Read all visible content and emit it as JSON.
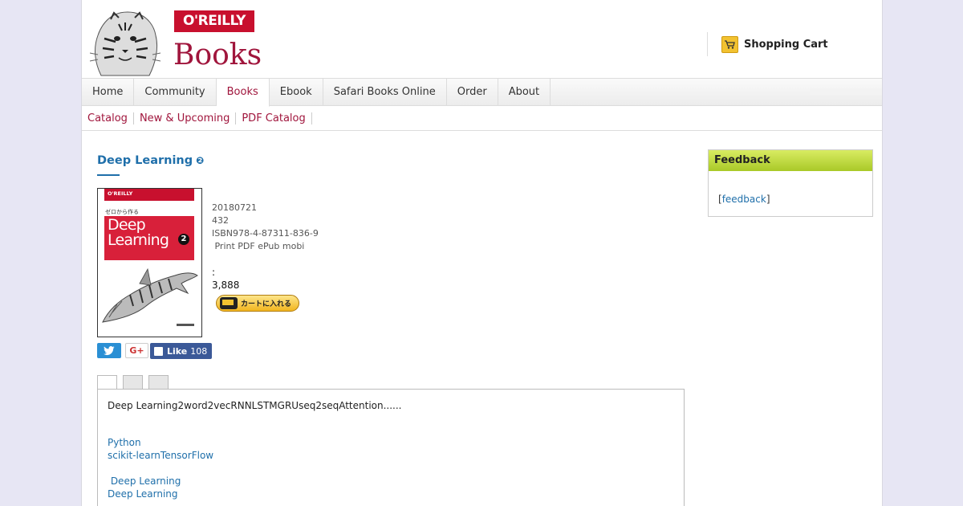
{
  "brand": {
    "logo_text": "O'REILLY",
    "books_text": "Books",
    "accent": "#a0153c",
    "logo_red": "#c8102e"
  },
  "header": {
    "cart_label": "Shopping Cart",
    "cart_icon": "shopping-cart-icon"
  },
  "nav": {
    "items": [
      "Home",
      "Community",
      "Books",
      "Ebook",
      "Safari Books Online",
      "Order",
      "About"
    ],
    "active": "Books"
  },
  "subnav": {
    "items": [
      "Catalog",
      "New & Upcoming",
      "PDF Catalog"
    ]
  },
  "book": {
    "title": "Deep Learning",
    "help_icon": "❷",
    "cover": {
      "logo": "O'REILLY",
      "subtitle": "ゼロから作る",
      "title_line1": "Deep",
      "title_line2": "Learning",
      "number": "2"
    },
    "date": "20180721",
    "pages": "432",
    "isbn": "ISBN978-4-87311-836-9",
    "formats": " Print PDF ePub mobi",
    "price_label": ":",
    "price": "3,888",
    "cart_button": "カートに入れる"
  },
  "social": {
    "gplus": "G+",
    "fb_like": "Like",
    "fb_count": "108"
  },
  "tabs": {
    "count": 3,
    "active_index": 0
  },
  "content": {
    "description": "Deep Learning2word2vecRNNLSTMGRUseq2seqAttention......",
    "links": [
      "Python",
      "scikit-learnTensorFlow",
      "",
      " Deep Learning",
      "Deep Learning"
    ]
  },
  "feedback": {
    "title": "Feedback",
    "open": "[",
    "link": "feedback",
    "close": "]"
  }
}
